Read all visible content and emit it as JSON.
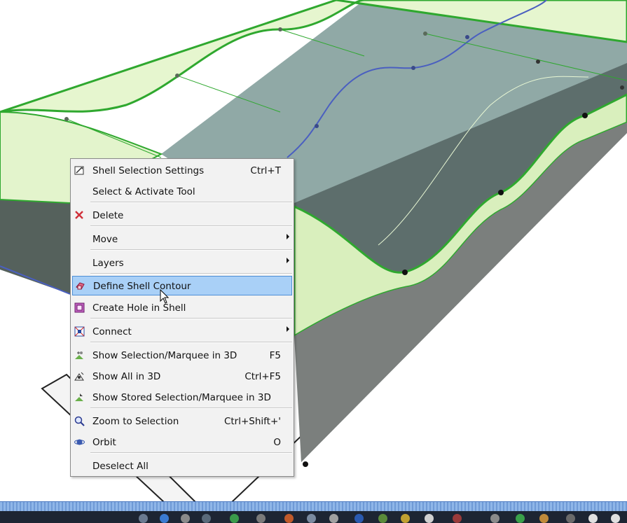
{
  "menu": {
    "items": [
      {
        "label": "Shell Selection Settings",
        "shortcut": "Ctrl+T",
        "icon": "shell-settings-icon"
      },
      {
        "label": "Select & Activate Tool",
        "shortcut": "",
        "icon": ""
      },
      {
        "label": "Delete",
        "shortcut": "",
        "icon": "delete-x-icon"
      },
      {
        "label": "Move",
        "shortcut": "",
        "icon": "",
        "submenu": true
      },
      {
        "label": "Layers",
        "shortcut": "",
        "icon": "",
        "submenu": true
      },
      {
        "label": "Define Shell Contour",
        "shortcut": "",
        "icon": "shell-contour-icon",
        "selected": true
      },
      {
        "label": "Create Hole in Shell",
        "shortcut": "",
        "icon": "shell-hole-icon"
      },
      {
        "label": "Connect",
        "shortcut": "",
        "icon": "connect-icon",
        "submenu": true
      },
      {
        "label": "Show Selection/Marquee in 3D",
        "shortcut": "F5",
        "icon": "show-selection-3d-icon"
      },
      {
        "label": "Show All in 3D",
        "shortcut": "Ctrl+F5",
        "icon": "show-all-3d-icon"
      },
      {
        "label": "Show Stored Selection/Marquee in 3D",
        "shortcut": "",
        "icon": "show-stored-3d-icon"
      },
      {
        "label": "Zoom to Selection",
        "shortcut": "Ctrl+Shift+'",
        "icon": "zoom-selection-icon"
      },
      {
        "label": "Orbit",
        "shortcut": "O",
        "icon": "orbit-icon"
      },
      {
        "label": "Deselect All",
        "shortcut": "",
        "icon": ""
      }
    ]
  },
  "colors": {
    "menu_bg": "#f2f2f2",
    "highlight": "#a9d0f7",
    "shell_green": "#2fa82f",
    "shell_fill": "#e6f6cf",
    "slab": "#6f8a88"
  }
}
